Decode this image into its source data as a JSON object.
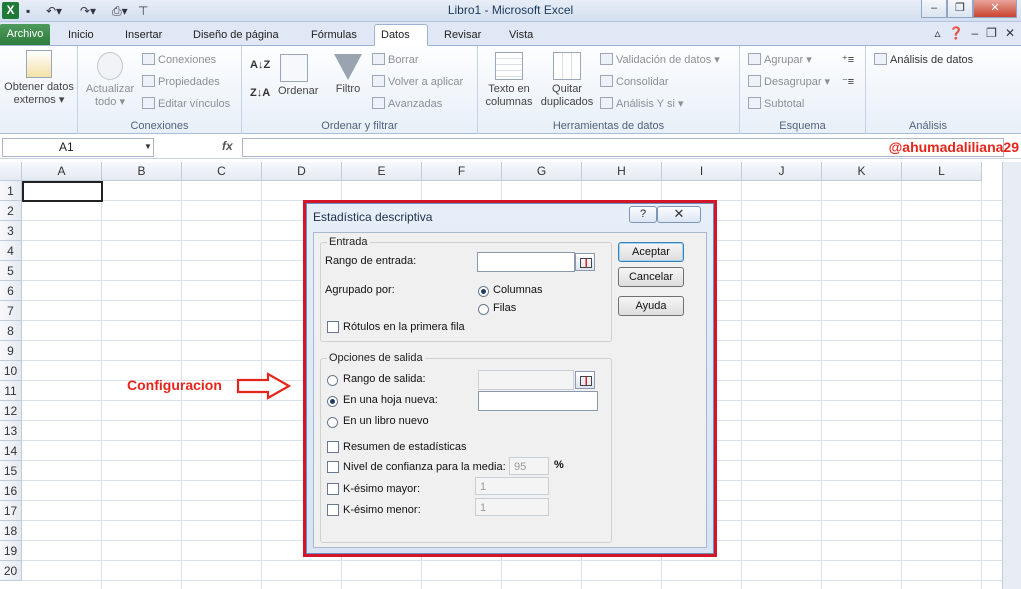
{
  "window": {
    "title": "Libro1  -  Microsoft Excel",
    "file_tab": "Archivo",
    "tabs": [
      "Inicio",
      "Insertar",
      "Diseño de página",
      "Fórmulas",
      "Datos",
      "Revisar",
      "Vista"
    ],
    "active_tab": "Datos"
  },
  "ribbon": {
    "external": {
      "label_line1": "Obtener datos",
      "label_line2": "externos ▾"
    },
    "connections": {
      "refresh_line1": "Actualizar",
      "refresh_line2": "todo ▾",
      "items": [
        "Conexiones",
        "Propiedades",
        "Editar vínculos"
      ],
      "group_label": "Conexiones"
    },
    "sort_filter": {
      "sort": "Ordenar",
      "filter": "Filtro",
      "items": [
        "Borrar",
        "Volver a aplicar",
        "Avanzadas"
      ],
      "group_label": "Ordenar y filtrar"
    },
    "data_tools": {
      "text_to_columns_line1": "Texto en",
      "text_to_columns_line2": "columnas",
      "remove_dups_line1": "Quitar",
      "remove_dups_line2": "duplicados",
      "items": [
        "Validación de datos ▾",
        "Consolidar",
        "Análisis Y si ▾"
      ],
      "group_label": "Herramientas de datos"
    },
    "outline": {
      "items": [
        "Agrupar ▾",
        "Desagrupar ▾",
        "Subtotal"
      ],
      "group_label": "Esquema"
    },
    "analysis": {
      "item": "Análisis de datos",
      "group_label": "Análisis"
    }
  },
  "formula_bar": {
    "name_box": "A1",
    "fx": "fx",
    "value": ""
  },
  "watermark_handle": "@ahumadaliliana29",
  "grid": {
    "columns": [
      "A",
      "B",
      "C",
      "D",
      "E",
      "F",
      "G",
      "H",
      "I",
      "J",
      "K",
      "L"
    ],
    "rows": [
      "1",
      "2",
      "3",
      "4",
      "5",
      "6",
      "7",
      "8",
      "9",
      "10",
      "11",
      "12",
      "13",
      "14",
      "15",
      "16",
      "17",
      "18",
      "19",
      "20"
    ]
  },
  "annotation": "Configuracion",
  "dialog": {
    "title": "Estadística descriptiva",
    "help_glyph": "?",
    "close_glyph": "✕",
    "input_group": "Entrada",
    "input_range_label": "Rango de entrada:",
    "grouped_by_label": "Agrupado por:",
    "columns_label": "Columnas",
    "rows_label": "Filas",
    "labels_first_row": "Rótulos en la primera fila",
    "output_group": "Opciones de salida",
    "output_range_label": "Rango de salida:",
    "new_sheet_label": "En una hoja nueva:",
    "new_book_label": "En un libro nuevo",
    "summary_stats": "Resumen de estadísticas",
    "confidence_label": "Nivel de confianza para la media:",
    "confidence_value": "95",
    "percent": "%",
    "kth_largest": "K-ésimo mayor:",
    "kth_largest_value": "1",
    "kth_smallest": "K-ésimo menor:",
    "kth_smallest_value": "1",
    "ok": "Aceptar",
    "cancel": "Cancelar",
    "help": "Ayuda"
  }
}
